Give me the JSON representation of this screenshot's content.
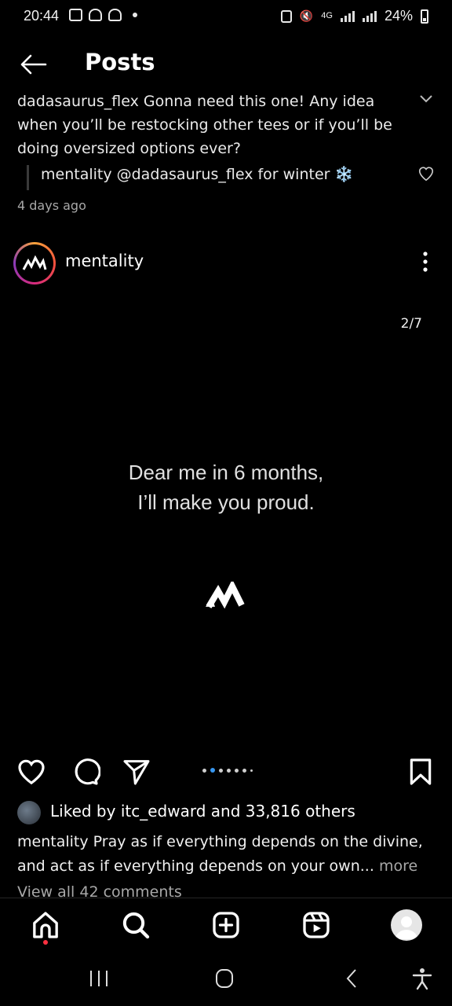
{
  "status_bar": {
    "time": "20:44",
    "battery": "24%",
    "network": "4G"
  },
  "header": {
    "title": "Posts"
  },
  "comment": {
    "username": "dadasaurus_flex",
    "text": "Gonna need this one! Any idea when you’ll be restocking other tees or if you’ll be doing oversized options ever?",
    "reply": "mentality @dadasaurus_flex for winter ❄️",
    "time": "4 days ago"
  },
  "post": {
    "username": "mentality",
    "slide_counter": "2/7",
    "media_line1": "Dear me in 6 months,",
    "media_line2": "I’ll make you proud.",
    "carousel": {
      "total": 7,
      "current": 2
    },
    "likes": {
      "prefix": "Liked by ",
      "user": "itc_edward",
      "middle": " and ",
      "count": "33,816 others"
    },
    "caption": {
      "username": "mentality",
      "text": " Pray as if everything depends on the divine, and act as if everything depends on your own...",
      "more": "more"
    },
    "view_comments": "View all 42 comments"
  },
  "icons": {
    "back": "back-arrow-icon",
    "chevron": "chevron-down-icon",
    "heart": "heart-icon",
    "comment": "comment-icon",
    "share": "send-icon",
    "save": "bookmark-icon",
    "home": "home-icon",
    "search": "search-icon",
    "create": "add-post-icon",
    "reels": "reels-icon",
    "profile": "profile-avatar"
  },
  "colors": {
    "accent": "#3897f0",
    "notification": "#ff3040",
    "muted": "#a8a8a8"
  }
}
